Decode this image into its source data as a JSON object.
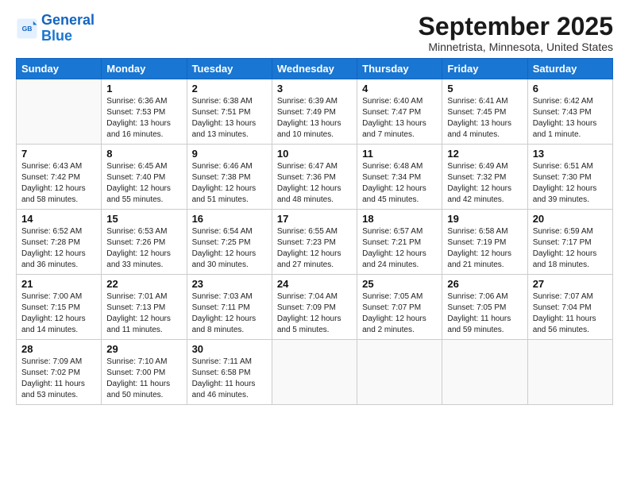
{
  "logo": {
    "line1": "General",
    "line2": "Blue"
  },
  "title": "September 2025",
  "location": "Minnetrista, Minnesota, United States",
  "days_of_week": [
    "Sunday",
    "Monday",
    "Tuesday",
    "Wednesday",
    "Thursday",
    "Friday",
    "Saturday"
  ],
  "weeks": [
    [
      {
        "day": "",
        "info": ""
      },
      {
        "day": "1",
        "info": "Sunrise: 6:36 AM\nSunset: 7:53 PM\nDaylight: 13 hours\nand 16 minutes."
      },
      {
        "day": "2",
        "info": "Sunrise: 6:38 AM\nSunset: 7:51 PM\nDaylight: 13 hours\nand 13 minutes."
      },
      {
        "day": "3",
        "info": "Sunrise: 6:39 AM\nSunset: 7:49 PM\nDaylight: 13 hours\nand 10 minutes."
      },
      {
        "day": "4",
        "info": "Sunrise: 6:40 AM\nSunset: 7:47 PM\nDaylight: 13 hours\nand 7 minutes."
      },
      {
        "day": "5",
        "info": "Sunrise: 6:41 AM\nSunset: 7:45 PM\nDaylight: 13 hours\nand 4 minutes."
      },
      {
        "day": "6",
        "info": "Sunrise: 6:42 AM\nSunset: 7:43 PM\nDaylight: 13 hours\nand 1 minute."
      }
    ],
    [
      {
        "day": "7",
        "info": "Sunrise: 6:43 AM\nSunset: 7:42 PM\nDaylight: 12 hours\nand 58 minutes."
      },
      {
        "day": "8",
        "info": "Sunrise: 6:45 AM\nSunset: 7:40 PM\nDaylight: 12 hours\nand 55 minutes."
      },
      {
        "day": "9",
        "info": "Sunrise: 6:46 AM\nSunset: 7:38 PM\nDaylight: 12 hours\nand 51 minutes."
      },
      {
        "day": "10",
        "info": "Sunrise: 6:47 AM\nSunset: 7:36 PM\nDaylight: 12 hours\nand 48 minutes."
      },
      {
        "day": "11",
        "info": "Sunrise: 6:48 AM\nSunset: 7:34 PM\nDaylight: 12 hours\nand 45 minutes."
      },
      {
        "day": "12",
        "info": "Sunrise: 6:49 AM\nSunset: 7:32 PM\nDaylight: 12 hours\nand 42 minutes."
      },
      {
        "day": "13",
        "info": "Sunrise: 6:51 AM\nSunset: 7:30 PM\nDaylight: 12 hours\nand 39 minutes."
      }
    ],
    [
      {
        "day": "14",
        "info": "Sunrise: 6:52 AM\nSunset: 7:28 PM\nDaylight: 12 hours\nand 36 minutes."
      },
      {
        "day": "15",
        "info": "Sunrise: 6:53 AM\nSunset: 7:26 PM\nDaylight: 12 hours\nand 33 minutes."
      },
      {
        "day": "16",
        "info": "Sunrise: 6:54 AM\nSunset: 7:25 PM\nDaylight: 12 hours\nand 30 minutes."
      },
      {
        "day": "17",
        "info": "Sunrise: 6:55 AM\nSunset: 7:23 PM\nDaylight: 12 hours\nand 27 minutes."
      },
      {
        "day": "18",
        "info": "Sunrise: 6:57 AM\nSunset: 7:21 PM\nDaylight: 12 hours\nand 24 minutes."
      },
      {
        "day": "19",
        "info": "Sunrise: 6:58 AM\nSunset: 7:19 PM\nDaylight: 12 hours\nand 21 minutes."
      },
      {
        "day": "20",
        "info": "Sunrise: 6:59 AM\nSunset: 7:17 PM\nDaylight: 12 hours\nand 18 minutes."
      }
    ],
    [
      {
        "day": "21",
        "info": "Sunrise: 7:00 AM\nSunset: 7:15 PM\nDaylight: 12 hours\nand 14 minutes."
      },
      {
        "day": "22",
        "info": "Sunrise: 7:01 AM\nSunset: 7:13 PM\nDaylight: 12 hours\nand 11 minutes."
      },
      {
        "day": "23",
        "info": "Sunrise: 7:03 AM\nSunset: 7:11 PM\nDaylight: 12 hours\nand 8 minutes."
      },
      {
        "day": "24",
        "info": "Sunrise: 7:04 AM\nSunset: 7:09 PM\nDaylight: 12 hours\nand 5 minutes."
      },
      {
        "day": "25",
        "info": "Sunrise: 7:05 AM\nSunset: 7:07 PM\nDaylight: 12 hours\nand 2 minutes."
      },
      {
        "day": "26",
        "info": "Sunrise: 7:06 AM\nSunset: 7:05 PM\nDaylight: 11 hours\nand 59 minutes."
      },
      {
        "day": "27",
        "info": "Sunrise: 7:07 AM\nSunset: 7:04 PM\nDaylight: 11 hours\nand 56 minutes."
      }
    ],
    [
      {
        "day": "28",
        "info": "Sunrise: 7:09 AM\nSunset: 7:02 PM\nDaylight: 11 hours\nand 53 minutes."
      },
      {
        "day": "29",
        "info": "Sunrise: 7:10 AM\nSunset: 7:00 PM\nDaylight: 11 hours\nand 50 minutes."
      },
      {
        "day": "30",
        "info": "Sunrise: 7:11 AM\nSunset: 6:58 PM\nDaylight: 11 hours\nand 46 minutes."
      },
      {
        "day": "",
        "info": ""
      },
      {
        "day": "",
        "info": ""
      },
      {
        "day": "",
        "info": ""
      },
      {
        "day": "",
        "info": ""
      }
    ]
  ]
}
